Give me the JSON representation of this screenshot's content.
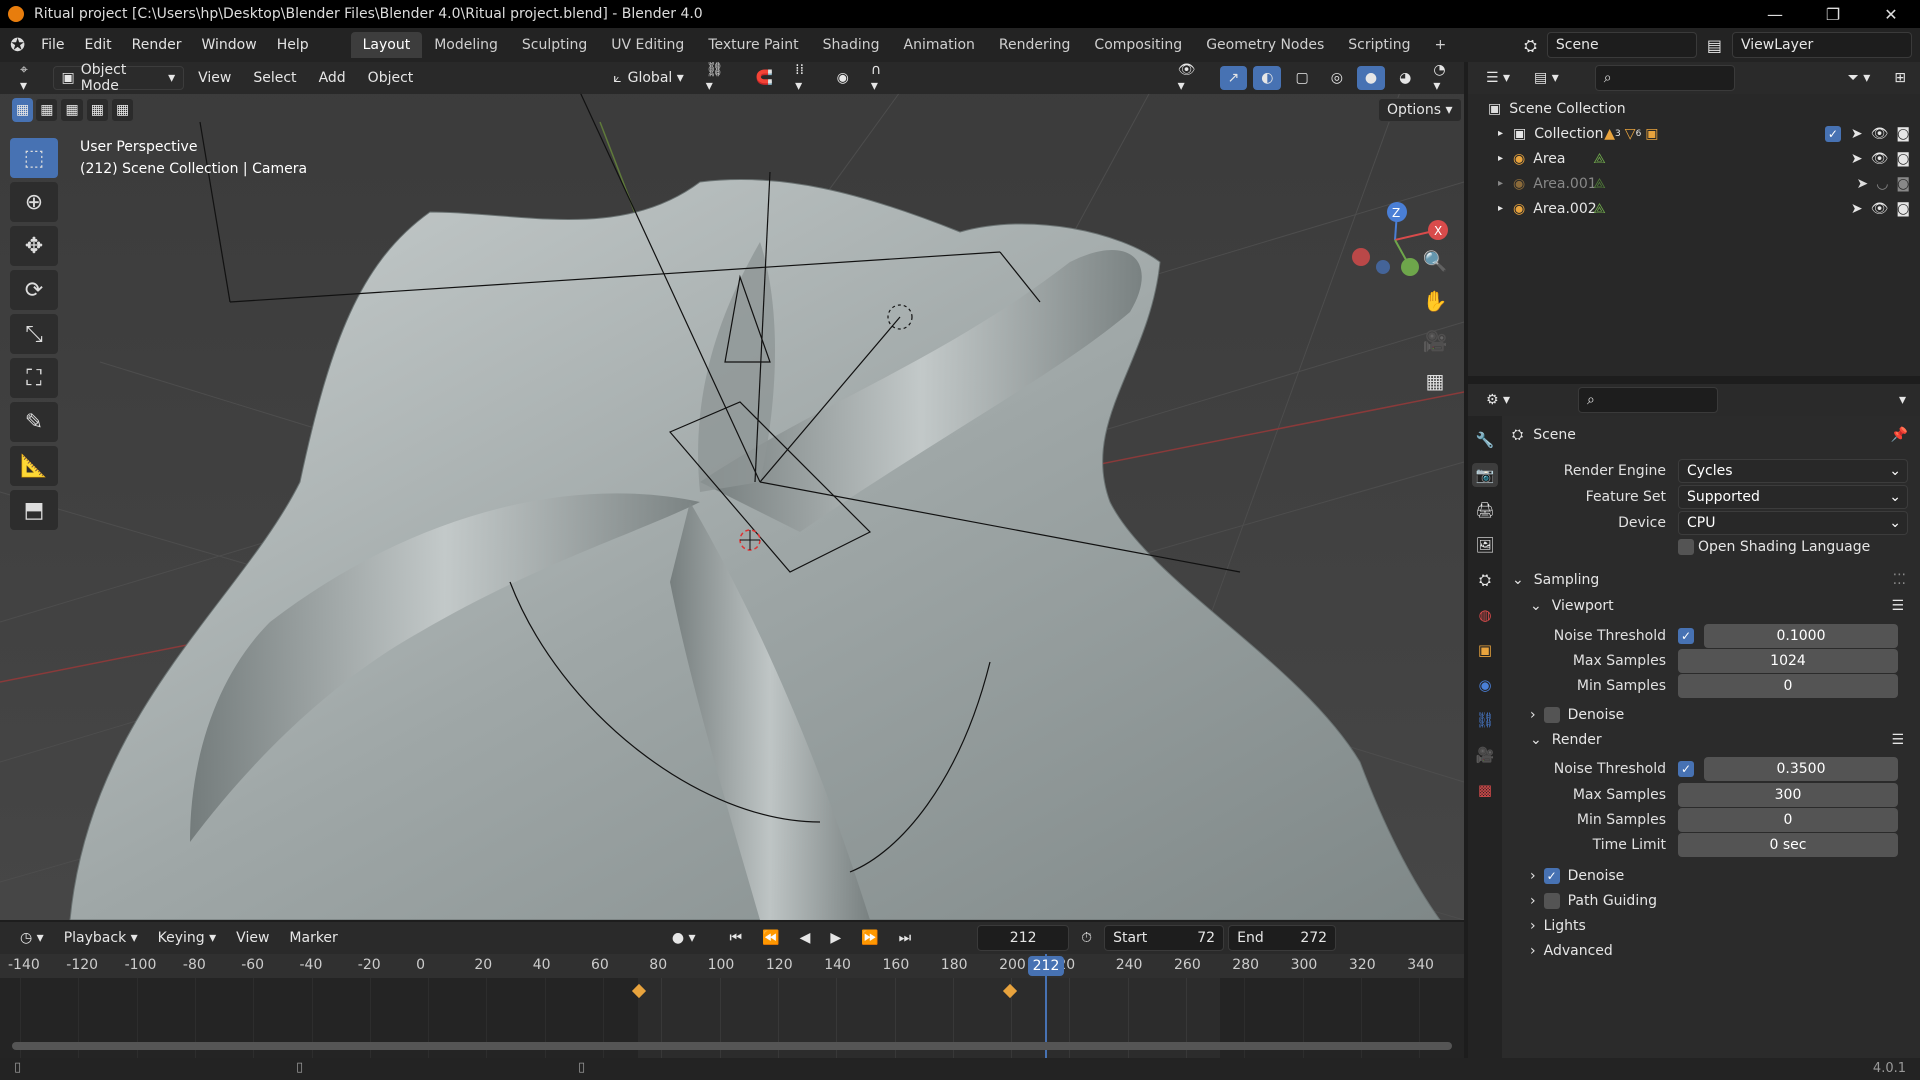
{
  "window": {
    "title": "Ritual project [C:\\Users\\hp\\Desktop\\Blender Files\\Blender 4.0\\Ritual project.blend] - Blender 4.0",
    "controls": [
      "—",
      "❐",
      "✕"
    ]
  },
  "menu": {
    "items": [
      "File",
      "Edit",
      "Render",
      "Window",
      "Help"
    ],
    "workspaces": [
      "Layout",
      "Modeling",
      "Sculpting",
      "UV Editing",
      "Texture Paint",
      "Shading",
      "Animation",
      "Rendering",
      "Compositing",
      "Geometry Nodes",
      "Scripting"
    ],
    "add_tab": "+",
    "scene_name": "Scene",
    "view_layer": "ViewLayer"
  },
  "viewport": {
    "mode": "Object Mode",
    "menus": [
      "View",
      "Select",
      "Add",
      "Object"
    ],
    "orientation": "Global",
    "options_label": "Options",
    "info_line1": "User Perspective",
    "info_line2": "(212) Scene Collection | Camera",
    "gizmo_axes": {
      "z": "Z",
      "x": "X"
    }
  },
  "timeline": {
    "menus": [
      "Playback",
      "Keying",
      "View",
      "Marker"
    ],
    "current_frame": "212",
    "start_label": "Start",
    "start": "72",
    "end_label": "End",
    "end": "272",
    "ruler": [
      "-140",
      "-120",
      "-100",
      "-80",
      "-60",
      "-40",
      "-20",
      "0",
      "20",
      "40",
      "60",
      "80",
      "100",
      "120",
      "140",
      "160",
      "180",
      "200",
      "20",
      "240",
      "260",
      "280",
      "300",
      "320",
      "340"
    ],
    "playhead_label": "212",
    "keyframes": [
      72,
      200
    ]
  },
  "outliner": {
    "root": "Scene Collection",
    "items": [
      {
        "name": "Collection",
        "badge1": "3",
        "badge2": "6",
        "dim": false
      },
      {
        "name": "Area",
        "dim": false
      },
      {
        "name": "Area.001",
        "dim": true
      },
      {
        "name": "Area.002",
        "dim": false
      }
    ]
  },
  "properties": {
    "context": "Scene",
    "render_engine_label": "Render Engine",
    "render_engine": "Cycles",
    "feature_set_label": "Feature Set",
    "feature_set": "Supported",
    "device_label": "Device",
    "device": "CPU",
    "osl_label": "Open Shading Language",
    "sampling": "Sampling",
    "viewport": "Viewport",
    "noise_threshold_label": "Noise Threshold",
    "vp_noise_threshold": "0.1000",
    "max_samples_label": "Max Samples",
    "vp_max_samples": "1024",
    "min_samples_label": "Min Samples",
    "vp_min_samples": "0",
    "denoise_label": "Denoise",
    "render": "Render",
    "r_noise_threshold": "0.3500",
    "r_max_samples": "300",
    "r_min_samples": "0",
    "time_limit_label": "Time Limit",
    "r_time_limit": "0 sec",
    "path_guiding_label": "Path Guiding",
    "lights_label": "Lights",
    "advanced_label": "Advanced"
  },
  "status": {
    "version": "4.0.1"
  },
  "colors": {
    "accent": "#4772b3",
    "orange": "#e8a33d",
    "playhead": "#4772b3"
  }
}
